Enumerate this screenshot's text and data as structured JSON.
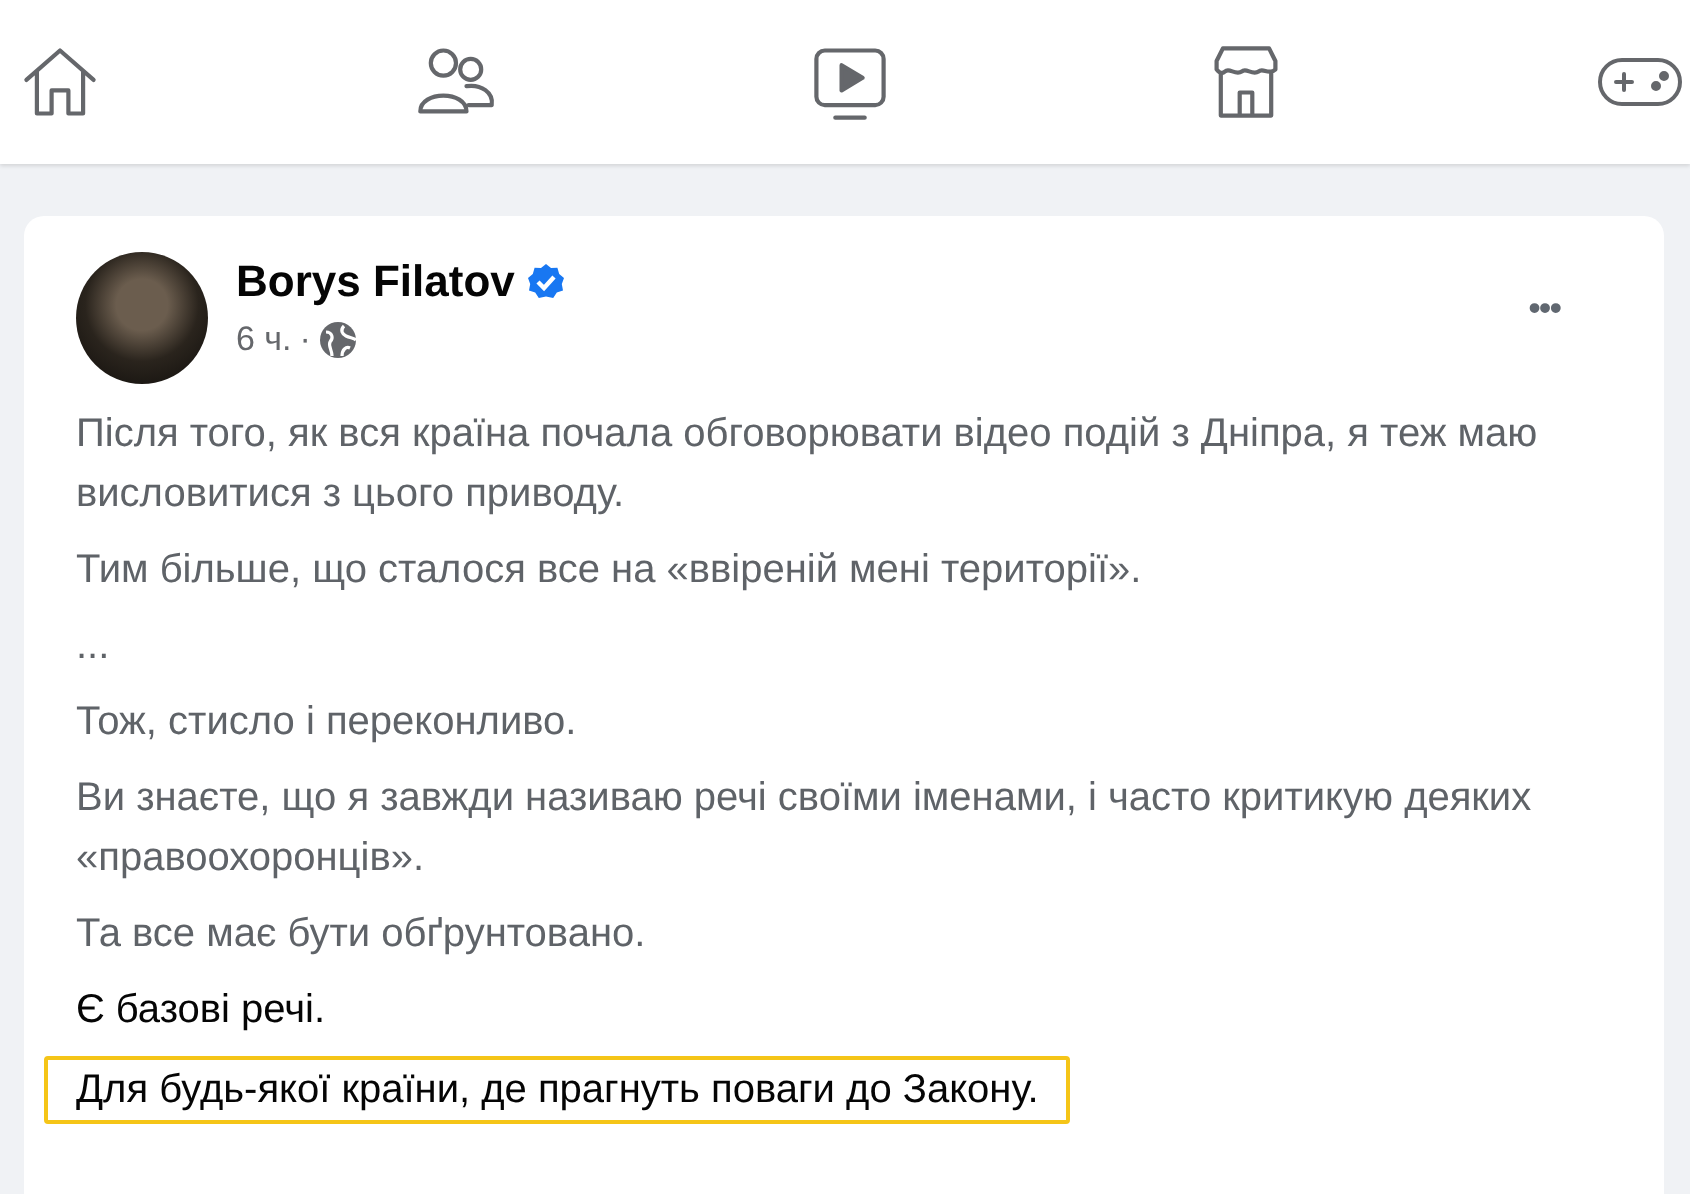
{
  "nav": {
    "items": [
      {
        "kind": "home",
        "selected": false
      },
      {
        "kind": "friends",
        "selected": false
      },
      {
        "kind": "video",
        "selected": false
      },
      {
        "kind": "marketplace",
        "selected": false
      },
      {
        "kind": "gaming",
        "selected": false
      }
    ]
  },
  "post": {
    "author": "Borys Filatov",
    "verified": true,
    "time": "6 ч.",
    "separator": "·",
    "menu": "•••",
    "paragraphs": [
      {
        "text": "Після того, як вся країна почала обговорювати відео подій з Дніпра, я теж маю висловитися з цього приводу.",
        "blurred": true,
        "highlighted": false
      },
      {
        "text": "Тим більше, що сталося все на «ввіреній мені території».",
        "blurred": true,
        "highlighted": false
      },
      {
        "text": "...",
        "blurred": true,
        "highlighted": false
      },
      {
        "text": "Тож, стисло і переконливо.",
        "blurred": true,
        "highlighted": false
      },
      {
        "text": "Ви знаєте, що я завжди називаю речі своїми іменами, і часто критикую деяких «правоохоронців».",
        "blurred": true,
        "highlighted": false
      },
      {
        "text": "Та все має бути обґрунтовано.",
        "blurred": true,
        "highlighted": false
      },
      {
        "text": "Є базові речі.",
        "blurred": false,
        "highlighted": false
      },
      {
        "text": "Для будь-якої країни, де прагнуть поваги до Закону.",
        "blurred": false,
        "highlighted": true
      }
    ]
  }
}
